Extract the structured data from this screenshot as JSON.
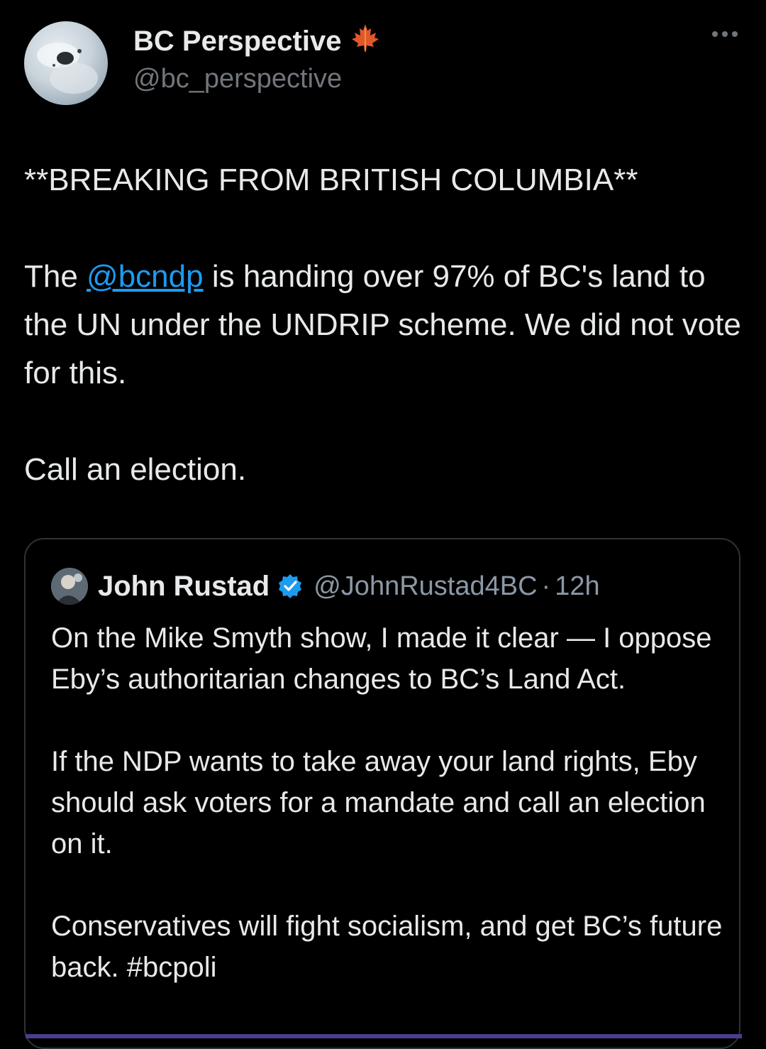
{
  "tweet": {
    "author": {
      "name": "BC Perspective",
      "badge_icon": "maple-leaf-icon",
      "handle": "@bc_perspective"
    },
    "more_icon": "more-options-icon",
    "paragraphs": {
      "p1": "**BREAKING FROM BRITISH COLUMBIA**",
      "p2_before": "The ",
      "p2_mention": "@bcndp",
      "p2_after": " is handing over 97% of BC's land to the UN under the UNDRIP scheme. We did not vote for this.",
      "p3": "Call an election."
    }
  },
  "quote": {
    "author": {
      "name": "John Rustad",
      "verified_icon": "verified-badge-icon",
      "handle": "@JohnRustad4BC",
      "dot": "·",
      "time": "12h"
    },
    "paragraphs": [
      "On the Mike Smyth show, I made it clear — I oppose Eby’s authoritarian changes to BC’s Land Act.",
      "If the NDP wants to take away your land rights, Eby should ask voters for a mandate and call an election on it.",
      "Conservatives will fight socialism, and get BC’s future back. #bcpoli"
    ]
  },
  "colors": {
    "background": "#000000",
    "text": "#e7e9ea",
    "secondary": "#71767b",
    "link": "#1d9bf0",
    "verified": "#1d9bf0",
    "maple": "#e0582a",
    "border": "#2f3336"
  }
}
